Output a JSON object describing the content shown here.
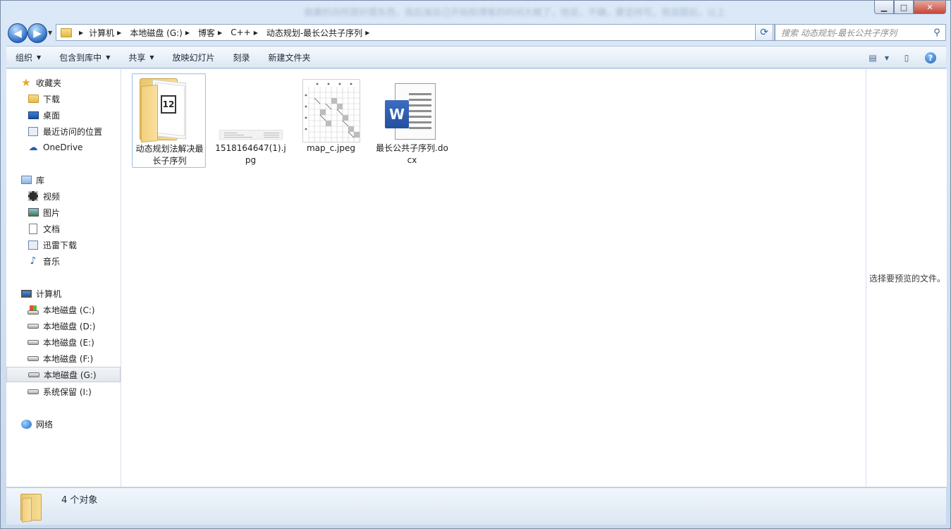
{
  "window": {
    "caption_min": "▁",
    "caption_max": "□",
    "caption_close": "✕",
    "blurred_title": "我撒的向阿搭好摆东西，我后海自己开始和博客的时间大概了。他说，不确，要坚持写。我说题后，以上"
  },
  "nav": {
    "back_glyph": "◀",
    "forward_glyph": "▶",
    "breadcrumbs": [
      "计算机",
      "本地磁盘 (G:)",
      "博客",
      "C++",
      "动态规划-最长公共子序列"
    ],
    "search_placeholder": "搜索 动态规划-最长公共子序列"
  },
  "toolbar": {
    "items": [
      "组织",
      "包含到库中",
      "共享",
      "放映幻灯片",
      "刻录",
      "新建文件夹"
    ]
  },
  "sidebar": {
    "favorites_label": "收藏夹",
    "favorites": [
      "下载",
      "桌面",
      "最近访问的位置",
      "OneDrive"
    ],
    "libraries_label": "库",
    "libraries": [
      "视频",
      "图片",
      "文档",
      "迅雷下载",
      "音乐"
    ],
    "computer_label": "计算机",
    "drives": [
      "本地磁盘 (C:)",
      "本地磁盘 (D:)",
      "本地磁盘 (E:)",
      "本地磁盘 (F:)",
      "本地磁盘 (G:)",
      "系统保留 (I:)"
    ],
    "network_label": "网络"
  },
  "files": [
    {
      "name": "动态规划法解决最长子序列",
      "type": "folder",
      "thumb_text": "12"
    },
    {
      "name": "1518164647(1).jpg",
      "type": "image-strip"
    },
    {
      "name": "map_c.jpeg",
      "type": "image-grid"
    },
    {
      "name": "最长公共子序列.docx",
      "type": "word",
      "badge": "W"
    }
  ],
  "preview": {
    "message": "选择要预览的文件。"
  },
  "status": {
    "count_text": "4 个对象"
  },
  "colors": {
    "accent": "#2e6fc6",
    "selection_border": "#a5c4e8"
  }
}
